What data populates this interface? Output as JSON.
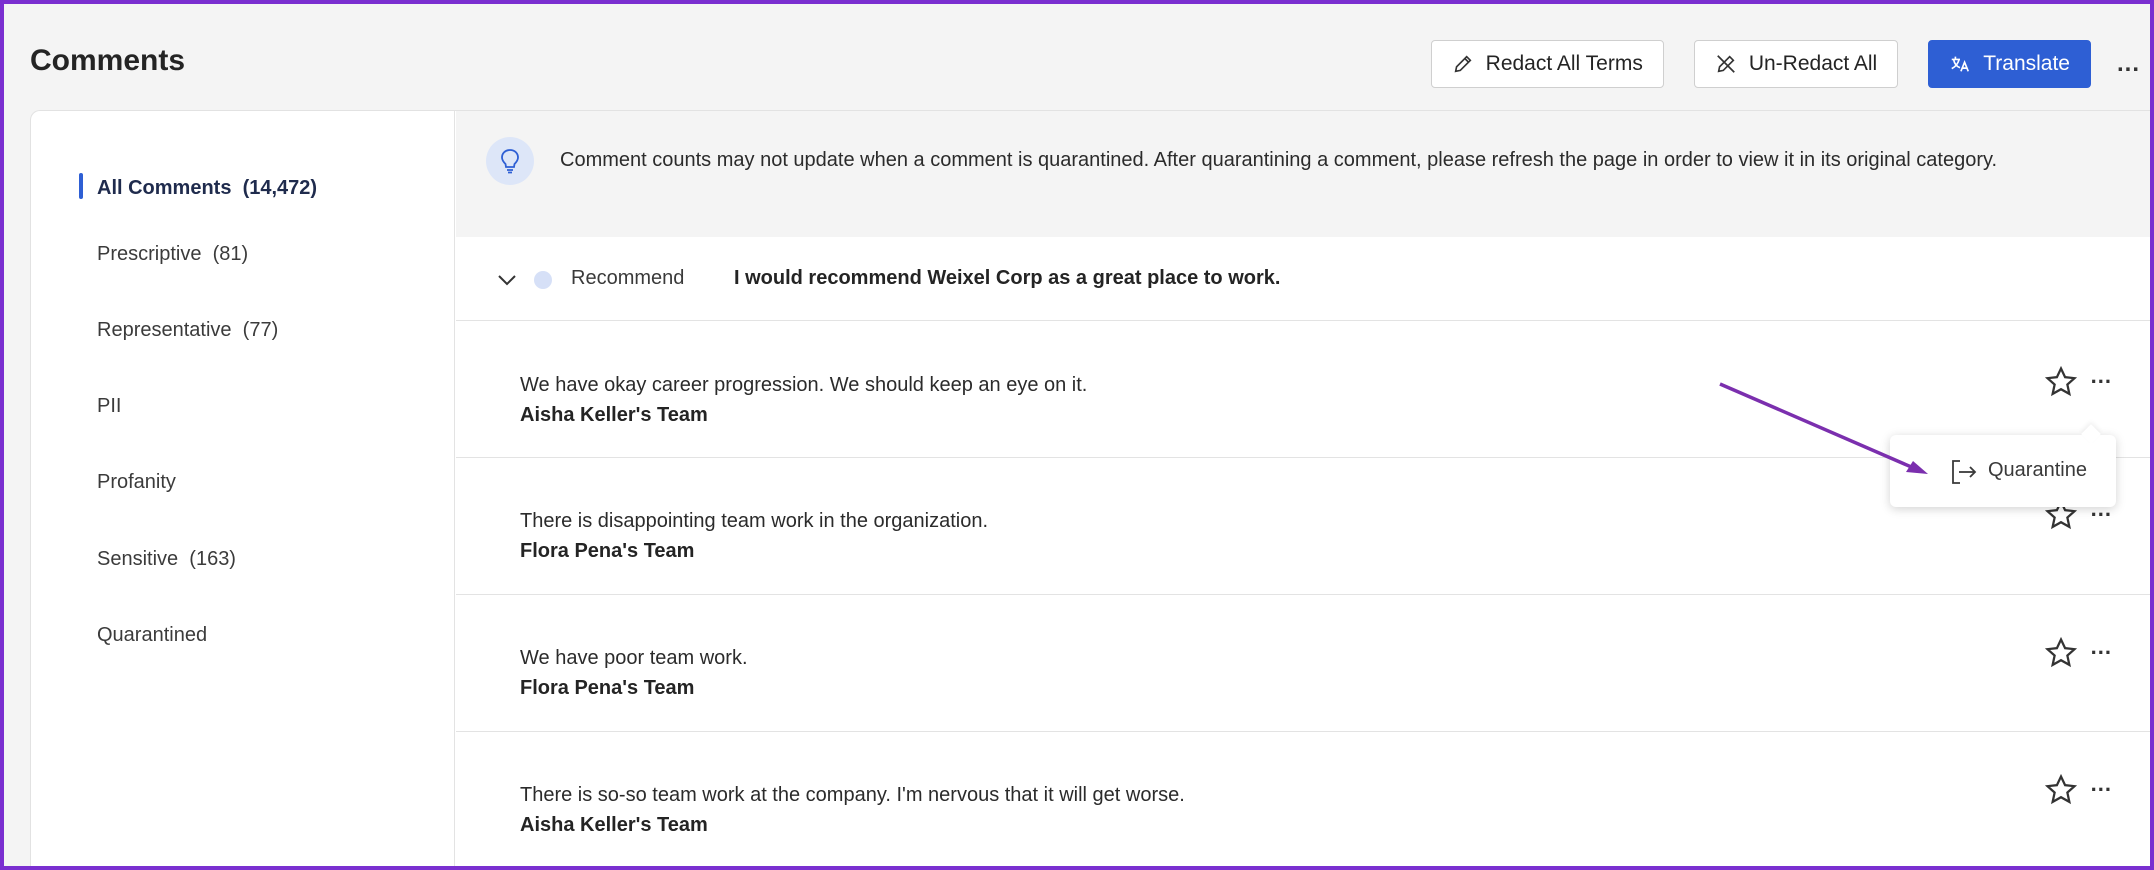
{
  "page": {
    "title": "Comments"
  },
  "toolbar": {
    "redact_label": "Redact All Terms",
    "unredact_label": "Un-Redact All",
    "translate_label": "Translate",
    "more_label": "..."
  },
  "sidebar": {
    "items": [
      {
        "label": "All Comments",
        "count": "(14,472)",
        "active": true
      },
      {
        "label": "Prescriptive",
        "count": "(81)"
      },
      {
        "label": "Representative",
        "count": "(77)"
      },
      {
        "label": "PII",
        "count": ""
      },
      {
        "label": "Profanity",
        "count": ""
      },
      {
        "label": "Sensitive",
        "count": "(163)"
      },
      {
        "label": "Quarantined",
        "count": ""
      }
    ]
  },
  "banner": {
    "icon": "lightbulb-icon",
    "text": "Comment counts may not update when a comment is quarantined. After quarantining a comment, please refresh the page in order to view it in its original category."
  },
  "question": {
    "label": "Recommend",
    "text": "I would recommend Weixel Corp as a great place to work."
  },
  "comments": [
    {
      "text": "We have okay career progression. We should keep an eye on it.",
      "team": "Aisha Keller's Team"
    },
    {
      "text": "There is disappointing team work in the organization.",
      "team": "Flora Pena's Team"
    },
    {
      "text": "We have poor team work.",
      "team": "Flora Pena's Team"
    },
    {
      "text": "There is so-so team work at the company. I'm nervous that it will get worse.",
      "team": "Aisha Keller's Team"
    }
  ],
  "comment_more_label": "...",
  "popover": {
    "label": "Quarantine"
  },
  "colors": {
    "accent": "#2e5fd4",
    "frame": "#7a2fd0",
    "arrow": "#7b2fae"
  }
}
